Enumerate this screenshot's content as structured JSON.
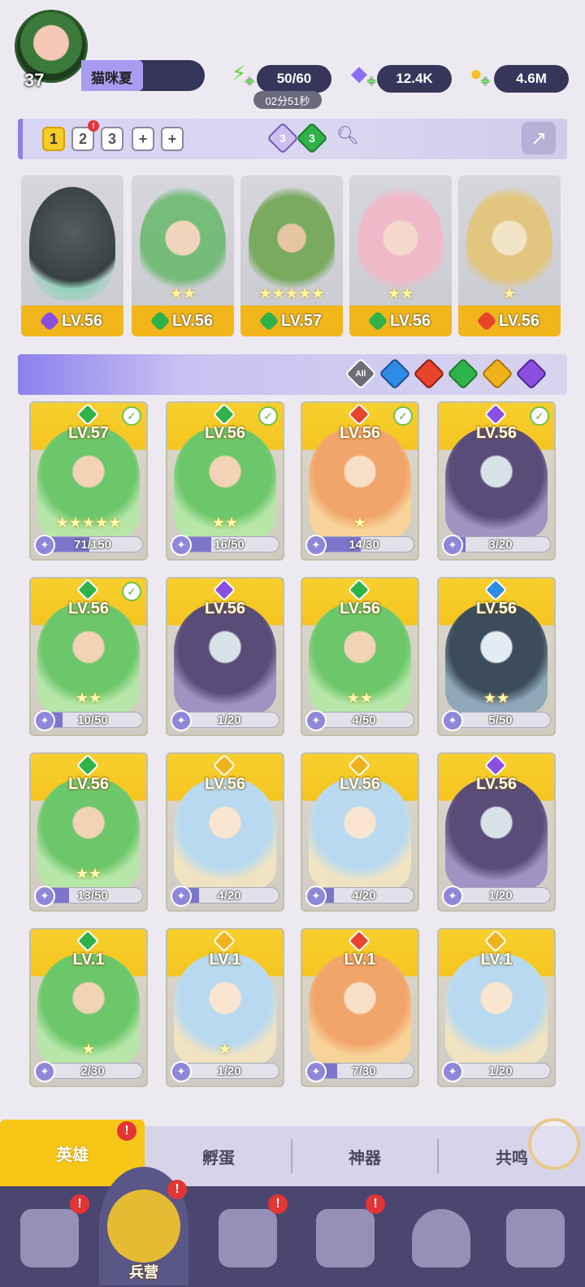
{
  "player": {
    "level": "37",
    "name": "猫咪夏"
  },
  "resources": [
    {
      "name": "energy",
      "value": "50/60",
      "icon": "lightning-icon",
      "color": "#5fd43a"
    },
    {
      "name": "gems",
      "value": "12.4K",
      "icon": "diamond-icon",
      "color": "#8a6cf5"
    },
    {
      "name": "gold",
      "value": "4.6M",
      "icon": "coin-icon",
      "color": "#f6c22a"
    }
  ],
  "energy_timer": "02分51秒",
  "team_tabs": [
    {
      "label": "1",
      "active": true
    },
    {
      "label": "2",
      "alert": true
    },
    {
      "label": "3"
    },
    {
      "label": "+"
    },
    {
      "label": "+"
    }
  ],
  "team_summary": [
    {
      "element": "dark",
      "count": "3"
    },
    {
      "element": "nature",
      "count": "3"
    }
  ],
  "team": [
    {
      "level": "LV.56",
      "element": "dark",
      "stars": ""
    },
    {
      "level": "LV.56",
      "element": "nature",
      "stars": "★★"
    },
    {
      "level": "LV.57",
      "element": "nature",
      "stars": "★★★★★"
    },
    {
      "level": "LV.56",
      "element": "nature",
      "stars": "★★"
    },
    {
      "level": "LV.56",
      "element": "fire",
      "stars": "★"
    }
  ],
  "filters": [
    {
      "label": "All",
      "icon": "all-filter-icon"
    },
    {
      "element": "water",
      "icon": "water-element-icon",
      "color": "#2e8be6"
    },
    {
      "element": "fire",
      "icon": "fire-element-icon",
      "color": "#e8432b"
    },
    {
      "element": "nature",
      "icon": "nature-element-icon",
      "color": "#2fb24a"
    },
    {
      "element": "light",
      "icon": "light-element-icon",
      "color": "#f0b21a"
    },
    {
      "element": "dark",
      "icon": "dark-element-icon",
      "color": "#8a4ee0"
    }
  ],
  "heroes": [
    {
      "level": "LV.57",
      "element": "nature",
      "shards": "71/150",
      "progress": 0.47,
      "check": true,
      "stars": "★★★★★"
    },
    {
      "level": "LV.56",
      "element": "nature",
      "shards": "16/50",
      "progress": 0.32,
      "check": true,
      "stars": "★★"
    },
    {
      "level": "LV.56",
      "element": "fire",
      "shards": "14/30",
      "progress": 0.47,
      "check": true,
      "stars": "★"
    },
    {
      "level": "LV.56",
      "element": "dark",
      "shards": "3/20",
      "progress": 0.15,
      "check": true,
      "stars": ""
    },
    {
      "level": "LV.56",
      "element": "nature",
      "shards": "10/50",
      "progress": 0.2,
      "check": true,
      "stars": "★★"
    },
    {
      "level": "LV.56",
      "element": "dark",
      "shards": "1/20",
      "progress": 0.05,
      "check": false,
      "stars": ""
    },
    {
      "level": "LV.56",
      "element": "nature",
      "shards": "4/50",
      "progress": 0.08,
      "check": false,
      "stars": "★★"
    },
    {
      "level": "LV.56",
      "element": "water",
      "shards": "5/50",
      "progress": 0.1,
      "check": false,
      "stars": "★★"
    },
    {
      "level": "LV.56",
      "element": "nature",
      "shards": "13/50",
      "progress": 0.26,
      "check": false,
      "stars": "★★"
    },
    {
      "level": "LV.56",
      "element": "light",
      "shards": "4/20",
      "progress": 0.2,
      "check": false,
      "stars": ""
    },
    {
      "level": "LV.56",
      "element": "light",
      "shards": "4/20",
      "progress": 0.2,
      "check": false,
      "stars": ""
    },
    {
      "level": "LV.56",
      "element": "dark",
      "shards": "1/20",
      "progress": 0.05,
      "check": false,
      "stars": ""
    },
    {
      "level": "LV.1",
      "element": "nature",
      "shards": "2/30",
      "progress": 0.07,
      "check": false,
      "stars": "★"
    },
    {
      "level": "LV.1",
      "element": "light",
      "shards": "1/20",
      "progress": 0.05,
      "check": false,
      "stars": "★"
    },
    {
      "level": "LV.1",
      "element": "fire",
      "shards": "7/30",
      "progress": 0.23,
      "check": false,
      "stars": ""
    },
    {
      "level": "LV.1",
      "element": "light",
      "shards": "1/20",
      "progress": 0.05,
      "check": false,
      "stars": ""
    }
  ],
  "element_colors": {
    "nature": "#2fb24a",
    "fire": "#e8432b",
    "dark": "#8a4ee0",
    "water": "#2e8be6",
    "light": "#f0b21a"
  },
  "sub_tabs": [
    {
      "label": "英雄",
      "active": true,
      "alert": true
    },
    {
      "label": "孵蛋"
    },
    {
      "label": "神器"
    },
    {
      "label": "共鸣"
    }
  ],
  "bottom_nav": [
    {
      "icon": "cards-icon",
      "label": "",
      "alert": true
    },
    {
      "icon": "barracks-icon",
      "label": "兵营",
      "active": true,
      "alert": true
    },
    {
      "icon": "map-book-icon",
      "label": "",
      "alert": true
    },
    {
      "icon": "castle-icon",
      "label": "",
      "alert": true
    },
    {
      "icon": "mushroom-house-icon",
      "label": ""
    },
    {
      "icon": "guild-banner-icon",
      "label": ""
    }
  ]
}
